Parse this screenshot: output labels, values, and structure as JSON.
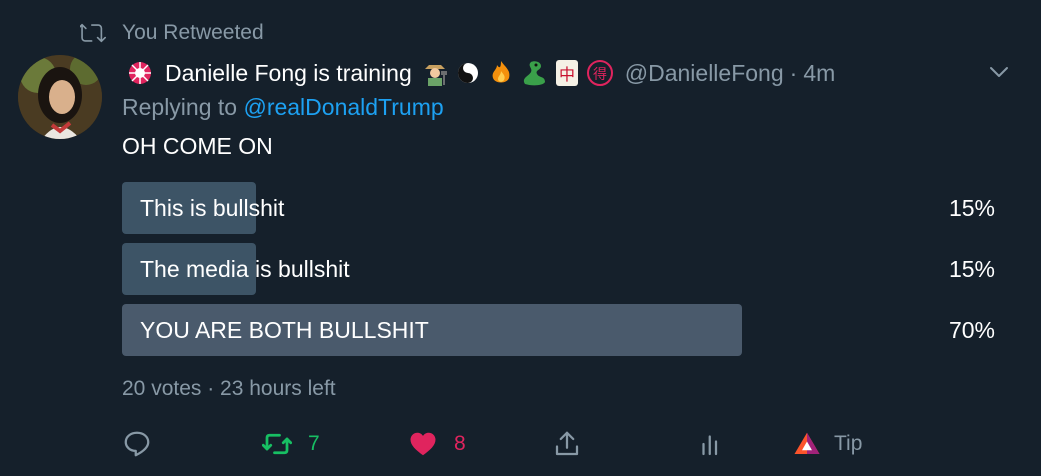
{
  "social_context": {
    "label": "You Retweeted"
  },
  "author": {
    "display_name": "Danielle Fong is training",
    "emojis": [
      "badge-icon",
      "farmer-icon",
      "yin-yang-icon",
      "fire-icon",
      "dragon-icon",
      "mahjong-icon",
      "circled-ideograph-icon"
    ],
    "handle": "@DanielleFong",
    "separator": "·",
    "time": "4m"
  },
  "reply": {
    "prefix": "Replying to",
    "mention": "@realDonaldTrump"
  },
  "text": "OH COME ON",
  "poll": {
    "options": [
      {
        "label": "This is bullshit",
        "pct_text": "15%",
        "fraction": 0.153
      },
      {
        "label": "The media is bullshit",
        "pct_text": "15%",
        "fraction": 0.153
      },
      {
        "label": "YOU ARE BOTH BULLSHIT",
        "pct_text": "70%",
        "fraction": 0.71
      }
    ],
    "meta": "20 votes · 23 hours left"
  },
  "actions": {
    "reply_count": "",
    "retweet_count": "7",
    "like_count": "8",
    "tip_label": "Tip"
  },
  "colors": {
    "background": "#15202b",
    "secondary_text": "#8899a6",
    "link": "#1da1f2",
    "retweet_active": "#17bf63",
    "like_active": "#e0245e",
    "poll_bar": "#3d5466"
  }
}
